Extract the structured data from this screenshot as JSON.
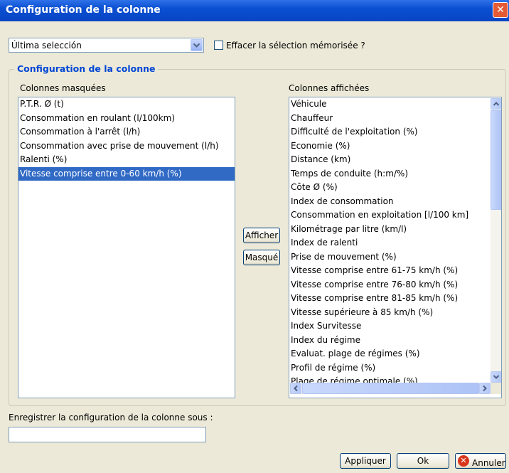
{
  "window": {
    "title": "Configuration de la colonne",
    "close_icon": "close-icon"
  },
  "selection": {
    "value": "Última selección",
    "clear_label": "Effacer la sélection mémorisée ?"
  },
  "group": {
    "title": "Configuration de la colonne"
  },
  "hidden": {
    "label": "Colonnes masquées",
    "items": [
      "P.T.R. Ø (t)",
      "Consommation en roulant (l/100km)",
      "Consommation à l'arrêt (l/h)",
      "Consommation avec prise de mouvement (l/h)",
      "Ralenti (%)",
      "Vitesse comprise entre 0-60 km/h (%)"
    ],
    "selected_index": 5
  },
  "buttons": {
    "show": "Afficher",
    "hide": "Masqué"
  },
  "shown": {
    "label": "Colonnes affichées",
    "items": [
      "Véhicule",
      "Chauffeur",
      "Difficulté de l'exploitation (%)",
      "Economie (%)",
      "Distance (km)",
      "Temps de conduite (h:m/%)",
      "Côte Ø (%)",
      "Index de consommation",
      "Consommation en exploitation [l/100 km]",
      "Kilométrage par litre (km/l)",
      "Index de ralenti",
      "Prise de mouvement (%)",
      "Vitesse comprise entre 61-75 km/h (%)",
      "Vitesse comprise entre 76-80 km/h (%)",
      "Vitesse comprise entre 81-85 km/h (%)",
      "Vitesse supérieure à 85 km/h (%)",
      "Index Survitesse",
      "Index du régime",
      "Evaluat. plage de régimes (%)",
      "Profil de régime (%)",
      "Plage de régime optimale (%)"
    ]
  },
  "save": {
    "label": "Enregistrer la configuration de la colonne sous :",
    "value": ""
  },
  "footer": {
    "apply": "Appliquer",
    "ok": "Ok",
    "cancel": "Annuler",
    "cancel_icon": "cancel-icon"
  }
}
